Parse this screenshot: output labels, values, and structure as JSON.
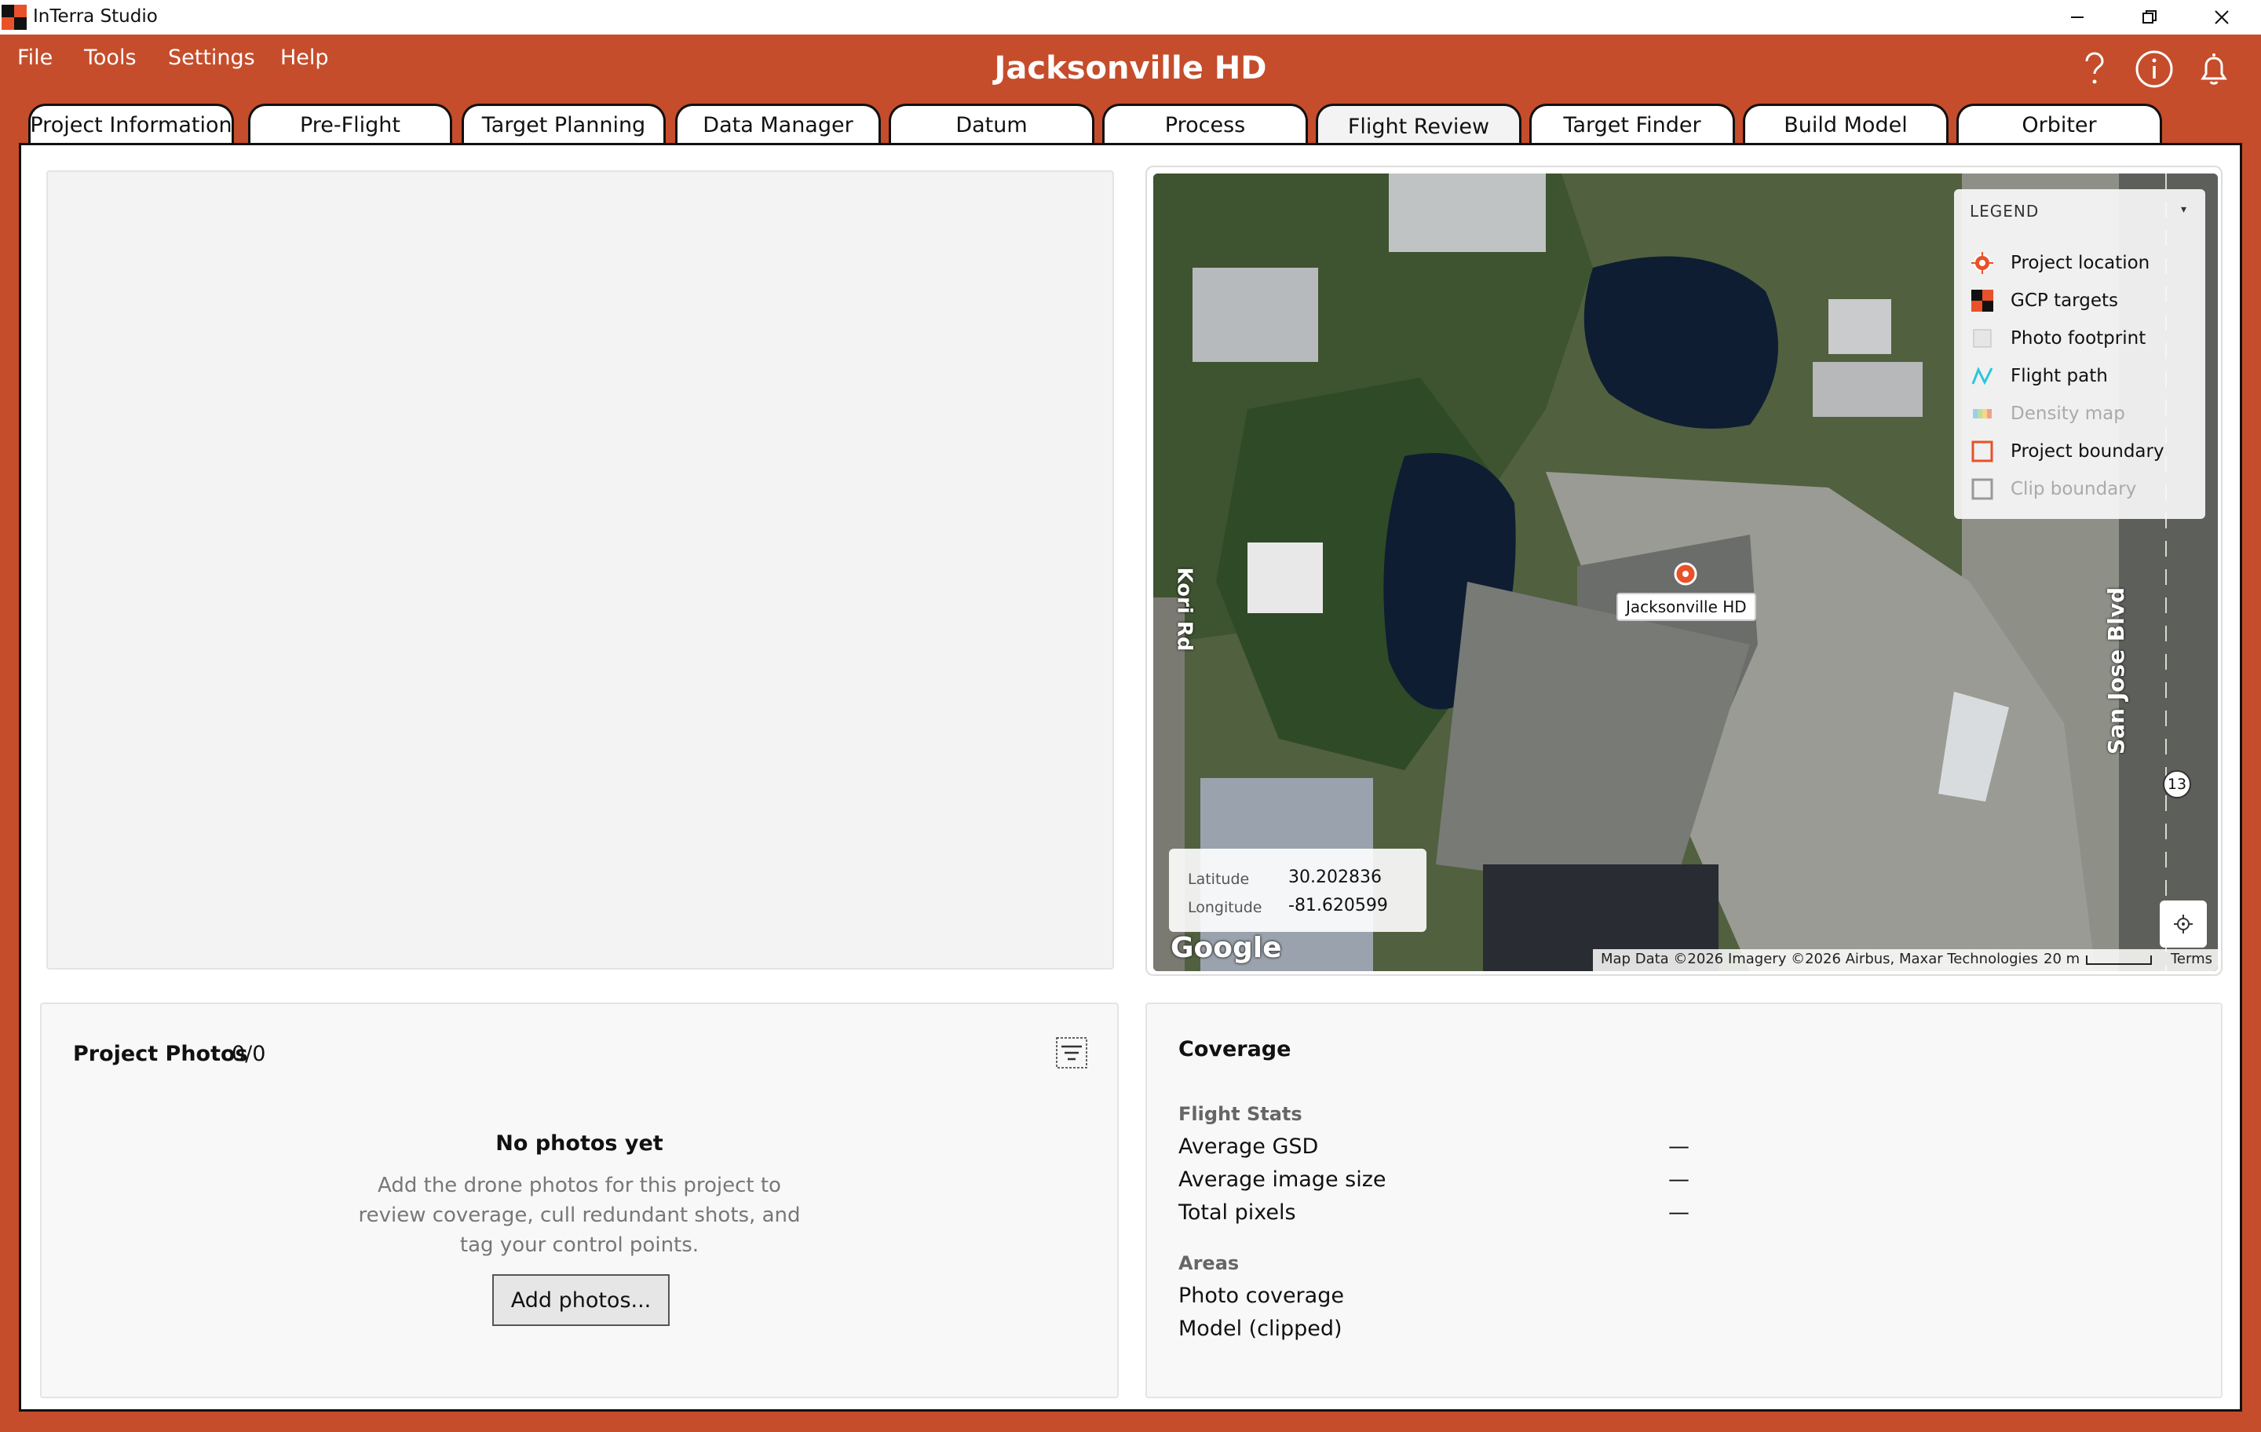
{
  "window": {
    "app_title": "InTerra Studio"
  },
  "menu": {
    "items": [
      "File",
      "Tools",
      "Settings",
      "Help"
    ]
  },
  "header": {
    "project_title": "Jacksonville HD"
  },
  "tabs": [
    {
      "label": "Project Information",
      "active": false
    },
    {
      "label": "Pre-Flight",
      "active": false
    },
    {
      "label": "Target Planning",
      "active": false
    },
    {
      "label": "Data Manager",
      "active": false
    },
    {
      "label": "Datum",
      "active": false
    },
    {
      "label": "Process",
      "active": false
    },
    {
      "label": "Flight Review",
      "active": true
    },
    {
      "label": "Target Finder",
      "active": false
    },
    {
      "label": "Build Model",
      "active": false
    },
    {
      "label": "Orbiter",
      "active": false
    }
  ],
  "colors": {
    "brand": "#c54d2b",
    "accent_orange": "#e8512a",
    "flight_path": "#2bc6d8"
  },
  "map": {
    "legend": {
      "title": "LEGEND",
      "items": [
        {
          "label": "Project location",
          "icon": "project-location-icon",
          "enabled": true
        },
        {
          "label": "GCP targets",
          "icon": "gcp-target-icon",
          "enabled": true
        },
        {
          "label": "Photo footprint",
          "icon": "photo-footprint-icon",
          "enabled": true
        },
        {
          "label": "Flight path",
          "icon": "flight-path-icon",
          "enabled": true
        },
        {
          "label": "Density map",
          "icon": "density-map-icon",
          "enabled": false
        },
        {
          "label": "Project boundary",
          "icon": "project-boundary-icon",
          "enabled": true
        },
        {
          "label": "Clip boundary",
          "icon": "clip-boundary-icon",
          "enabled": false
        }
      ]
    },
    "pin_label": "Jacksonville HD",
    "road_labels": {
      "kori": "Kori Rd",
      "san_jose": "San Jose Blvd",
      "route": "13"
    },
    "coords": {
      "lat_label": "Latitude",
      "lat_value": "30.202836",
      "lon_label": "Longitude",
      "lon_value": "-81.620599"
    },
    "attribution": "Map Data ©2026 Imagery ©2026 Airbus, Maxar Technologies",
    "scale": "20 m",
    "terms": "Terms",
    "logo": "Google"
  },
  "photos": {
    "title": "Project Photos",
    "count": "0/0",
    "empty_title": "No photos yet",
    "empty_text": "Add the drone photos for this project to review coverage, cull redundant shots, and tag your control points.",
    "add_button": "Add photos..."
  },
  "coverage": {
    "title": "Coverage",
    "flight_stats_label": "Flight Stats",
    "stats": [
      {
        "label": "Average GSD",
        "value": "—"
      },
      {
        "label": "Average image size",
        "value": "—"
      },
      {
        "label": "Total pixels",
        "value": "—"
      }
    ],
    "areas_label": "Areas",
    "areas": [
      "Photo coverage",
      "Model (clipped)"
    ]
  }
}
